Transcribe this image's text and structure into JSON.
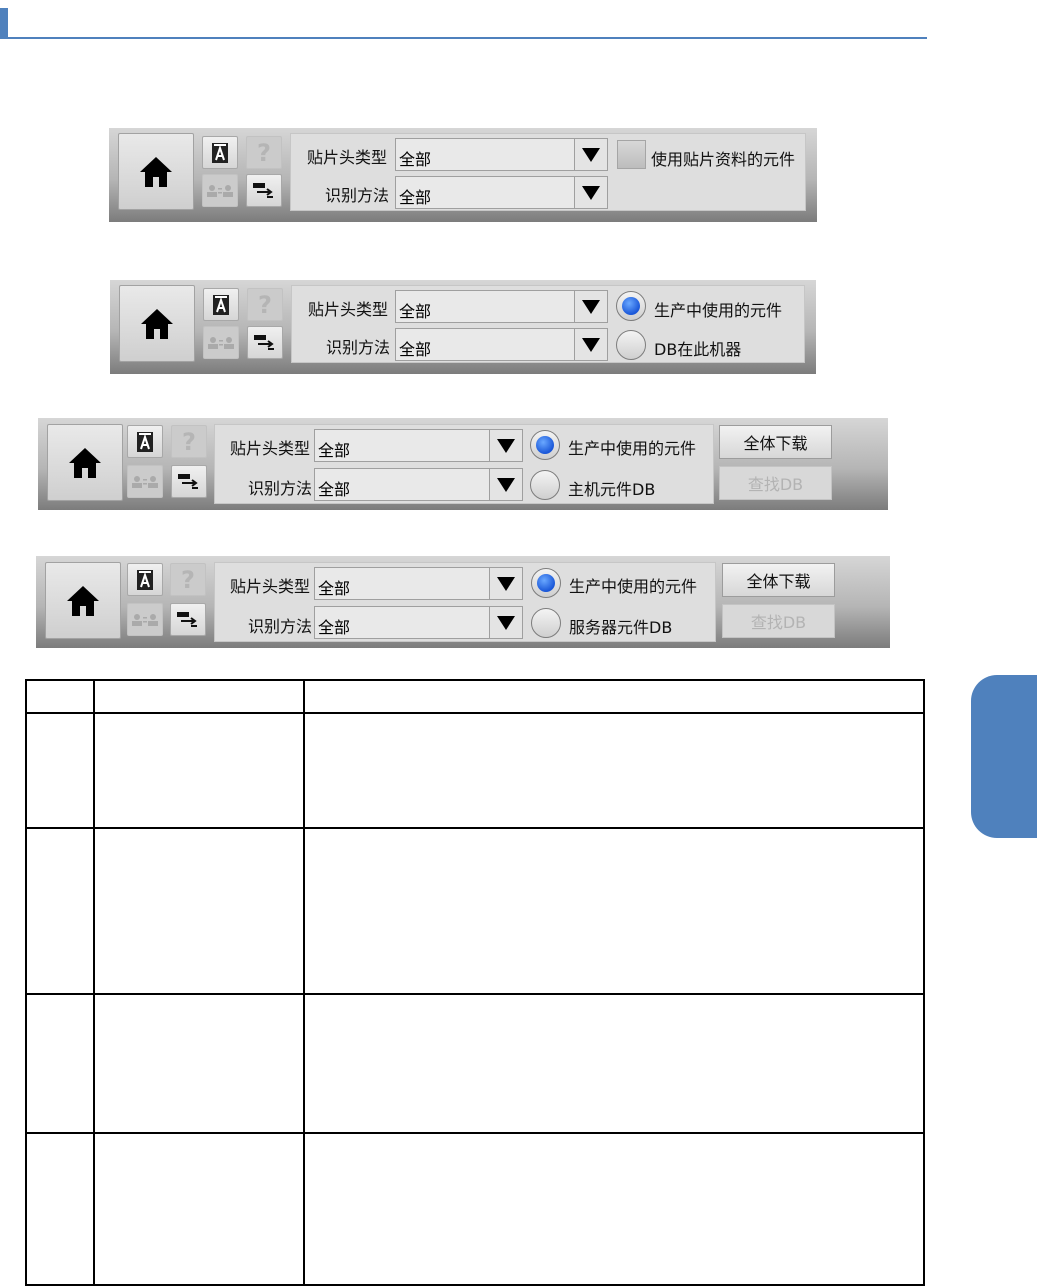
{
  "common": {
    "head_type_label": "贴片头类型",
    "recog_method_label": "识别方法",
    "head_type_value": "全部",
    "recog_method_value": "全部"
  },
  "toolbar1": {
    "checkbox_label": "使用贴片资料的元件"
  },
  "toolbar2": {
    "radio1_label": "生产中使用的元件",
    "radio2_label": "DB在此机器"
  },
  "toolbar3": {
    "radio1_label": "生产中使用的元件",
    "radio2_label": "主机元件DB",
    "download_all": "全体下载",
    "search_db": "查找DB"
  },
  "toolbar4": {
    "radio1_label": "生产中使用的元件",
    "radio2_label": "服务器元件DB",
    "download_all": "全体下载",
    "search_db": "查找DB"
  },
  "colors": {
    "accent": "#4f81bd",
    "radio_selected": "#1a57d8"
  },
  "icons": [
    "home-icon",
    "font-a-icon",
    "help-icon",
    "users-icon",
    "transfer-icon"
  ]
}
